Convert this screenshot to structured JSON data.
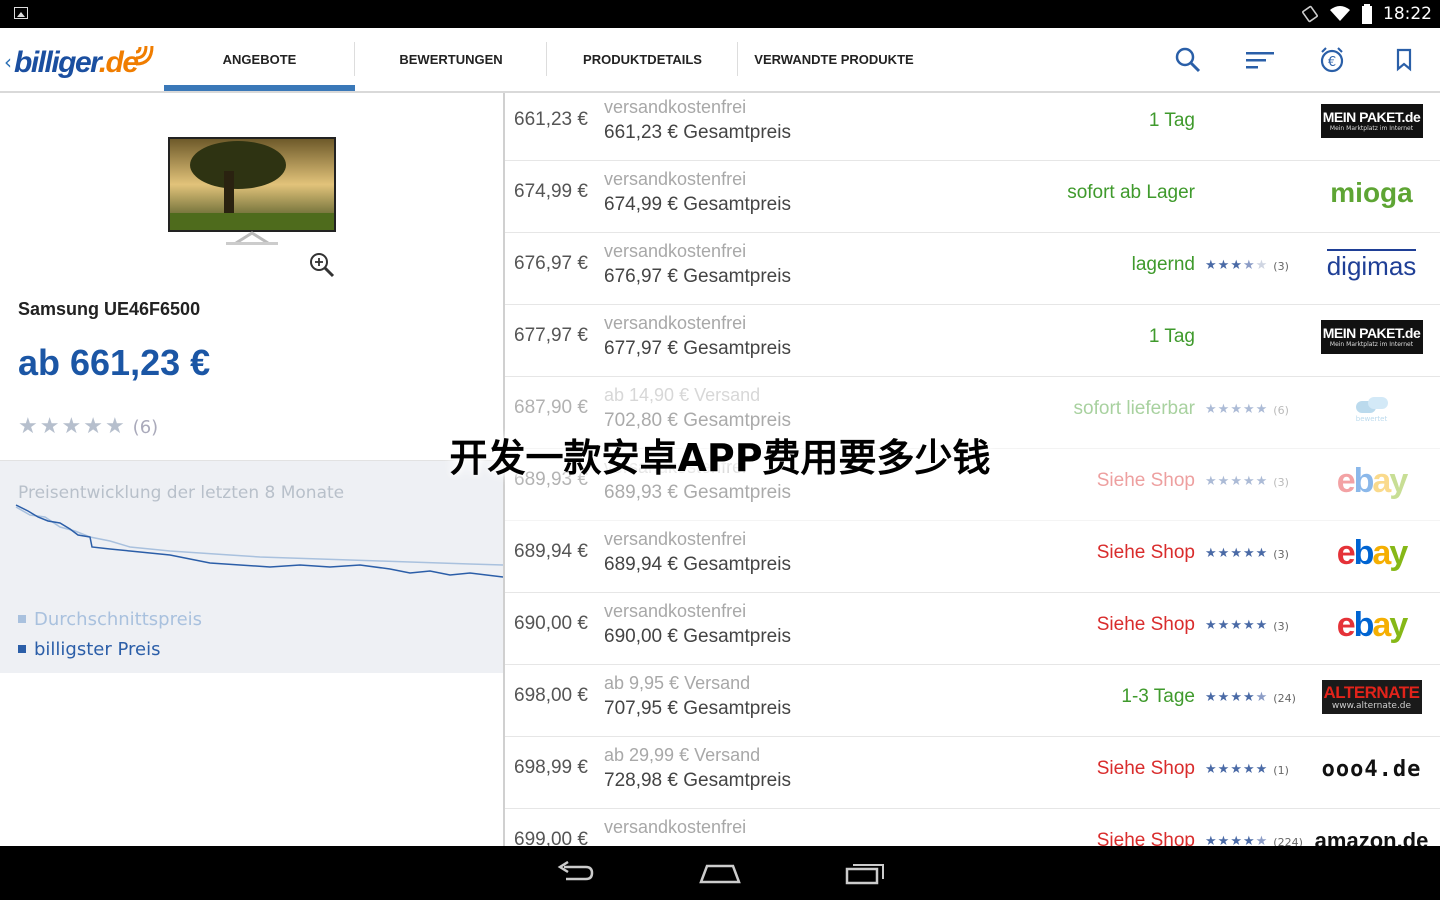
{
  "status_bar": {
    "time": "18:22"
  },
  "app": {
    "logo_main": "billiger",
    "logo_tld": ".de"
  },
  "tabs": [
    {
      "label": "ANGEBOTE",
      "active": true
    },
    {
      "label": "BEWERTUNGEN",
      "active": false
    },
    {
      "label": "PRODUKTDETAILS",
      "active": false
    },
    {
      "label": "VERWANDTE PRODUKTE",
      "active": false
    }
  ],
  "actions": [
    "search-icon",
    "sort-icon",
    "euro-alarm-icon",
    "bookmark-icon"
  ],
  "product": {
    "name": "Samsung UE46F6500",
    "price": "ab 661,23 €",
    "rating_count": "(6)"
  },
  "price_chart": {
    "title": "Preisentwicklung der letzten 8 Monate",
    "legend": [
      "Durchschnittspreis",
      "billigster Preis"
    ],
    "colors": {
      "avg": "#a9c1de",
      "min": "#2b5ea8"
    }
  },
  "offers": [
    {
      "price": "661,23 €",
      "shipping": "versandkostenfrei",
      "total": "661,23 € Gesamtpreis",
      "availability": "1 Tag",
      "avail_color": "green",
      "rating": 0,
      "rating_count": "",
      "shop": "meinpaket"
    },
    {
      "price": "674,99 €",
      "shipping": "versandkostenfrei",
      "total": "674,99 € Gesamtpreis",
      "availability": "sofort ab Lager",
      "avail_color": "green",
      "rating": 0,
      "rating_count": "",
      "shop": "mioga"
    },
    {
      "price": "676,97 €",
      "shipping": "versandkostenfrei",
      "total": "676,97 € Gesamtpreis",
      "availability": "lagernd",
      "avail_color": "green",
      "rating": 3.5,
      "rating_count": "(3)",
      "shop": "digimas"
    },
    {
      "price": "677,97 €",
      "shipping": "versandkostenfrei",
      "total": "677,97 € Gesamtpreis",
      "availability": "1 Tag",
      "avail_color": "green",
      "rating": 0,
      "rating_count": "",
      "shop": "meinpaket"
    },
    {
      "price": "687,90 €",
      "shipping": "ab 14,90 € Versand",
      "total": "702,80 € Gesamtpreis",
      "availability": "sofort lieferbar",
      "avail_color": "green",
      "rating": 5,
      "rating_count": "(6)",
      "shop": "cloud"
    },
    {
      "price": "689,93 €",
      "shipping": "versandkostenfrei",
      "total": "689,93 € Gesamtpreis",
      "availability": "Siehe Shop",
      "avail_color": "red",
      "rating": 5,
      "rating_count": "(3)",
      "shop": "ebay"
    },
    {
      "price": "689,94 €",
      "shipping": "versandkostenfrei",
      "total": "689,94 € Gesamtpreis",
      "availability": "Siehe Shop",
      "avail_color": "red",
      "rating": 5,
      "rating_count": "(3)",
      "shop": "ebay"
    },
    {
      "price": "690,00 €",
      "shipping": "versandkostenfrei",
      "total": "690,00 € Gesamtpreis",
      "availability": "Siehe Shop",
      "avail_color": "red",
      "rating": 5,
      "rating_count": "(3)",
      "shop": "ebay"
    },
    {
      "price": "698,00 €",
      "shipping": "ab 9,95 € Versand",
      "total": "707,95 € Gesamtpreis",
      "availability": "1-3 Tage",
      "avail_color": "green",
      "rating": 4.5,
      "rating_count": "(24)",
      "shop": "alternate"
    },
    {
      "price": "698,99 €",
      "shipping": "ab 29,99 € Versand",
      "total": "728,98 € Gesamtpreis",
      "availability": "Siehe Shop",
      "avail_color": "red",
      "rating": 5,
      "rating_count": "(1)",
      "shop": "ooo4"
    },
    {
      "price": "699,00 €",
      "shipping": "versandkostenfrei",
      "total": "",
      "availability": "Siehe Shop",
      "avail_color": "red",
      "rating": 4.5,
      "rating_count": "(224)",
      "shop": "amazon"
    }
  ],
  "shop_logos": {
    "meinpaket": {
      "line1": "MEIN PAKET.de",
      "line2": "Mein Marktplatz im Internet"
    },
    "mioga": {
      "text": "mioga"
    },
    "digimas": {
      "text": "digimas"
    },
    "cloud": {
      "text": "bewertet"
    },
    "ebay": {
      "e": "e",
      "b": "b",
      "a": "a",
      "y": "y"
    },
    "alternate": {
      "line1": "ALTERNATE",
      "line2": "www.alternate.de"
    },
    "ooo4": {
      "text": "ooo4.de"
    },
    "amazon": {
      "text": "amazon.de"
    }
  },
  "overlay_text": "开发一款安卓APP费用要多少钱"
}
